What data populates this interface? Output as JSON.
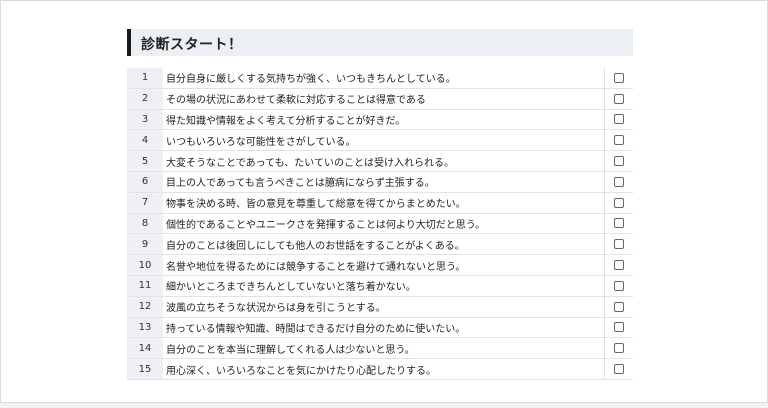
{
  "section": {
    "title": "診断スタート！"
  },
  "questions": [
    {
      "num": "1",
      "text": "自分自身に厳しくする気持ちが強く、いつもきちんとしている。"
    },
    {
      "num": "2",
      "text": "その場の状況にあわせて柔軟に対応することは得意である"
    },
    {
      "num": "3",
      "text": "得た知識や情報をよく考えて分析することが好きだ。"
    },
    {
      "num": "4",
      "text": "いつもいろいろな可能性をさがしている。"
    },
    {
      "num": "5",
      "text": "大変そうなことであっても、たいていのことは受け入れられる。"
    },
    {
      "num": "6",
      "text": "目上の人であっても言うべきことは臆病にならず主張する。"
    },
    {
      "num": "7",
      "text": "物事を決める時、皆の意見を尊重して総意を得てからまとめたい。"
    },
    {
      "num": "8",
      "text": "個性的であることやユニークさを発揮することは何より大切だと思う。"
    },
    {
      "num": "9",
      "text": "自分のことは後回しにしても他人のお世話をすることがよくある。"
    },
    {
      "num": "10",
      "text": "名誉や地位を得るためには競争することを避けて通れないと思う。"
    },
    {
      "num": "11",
      "text": "細かいところまできちんとしていないと落ち着かない。"
    },
    {
      "num": "12",
      "text": "波風の立ちそうな状況からは身を引こうとする。"
    },
    {
      "num": "13",
      "text": "持っている情報や知識、時間はできるだけ自分のために使いたい。"
    },
    {
      "num": "14",
      "text": "自分のことを本当に理解してくれる人は少ないと思う。"
    },
    {
      "num": "15",
      "text": "用心深く、いろいろなことを気にかけたり心配したりする。"
    }
  ]
}
